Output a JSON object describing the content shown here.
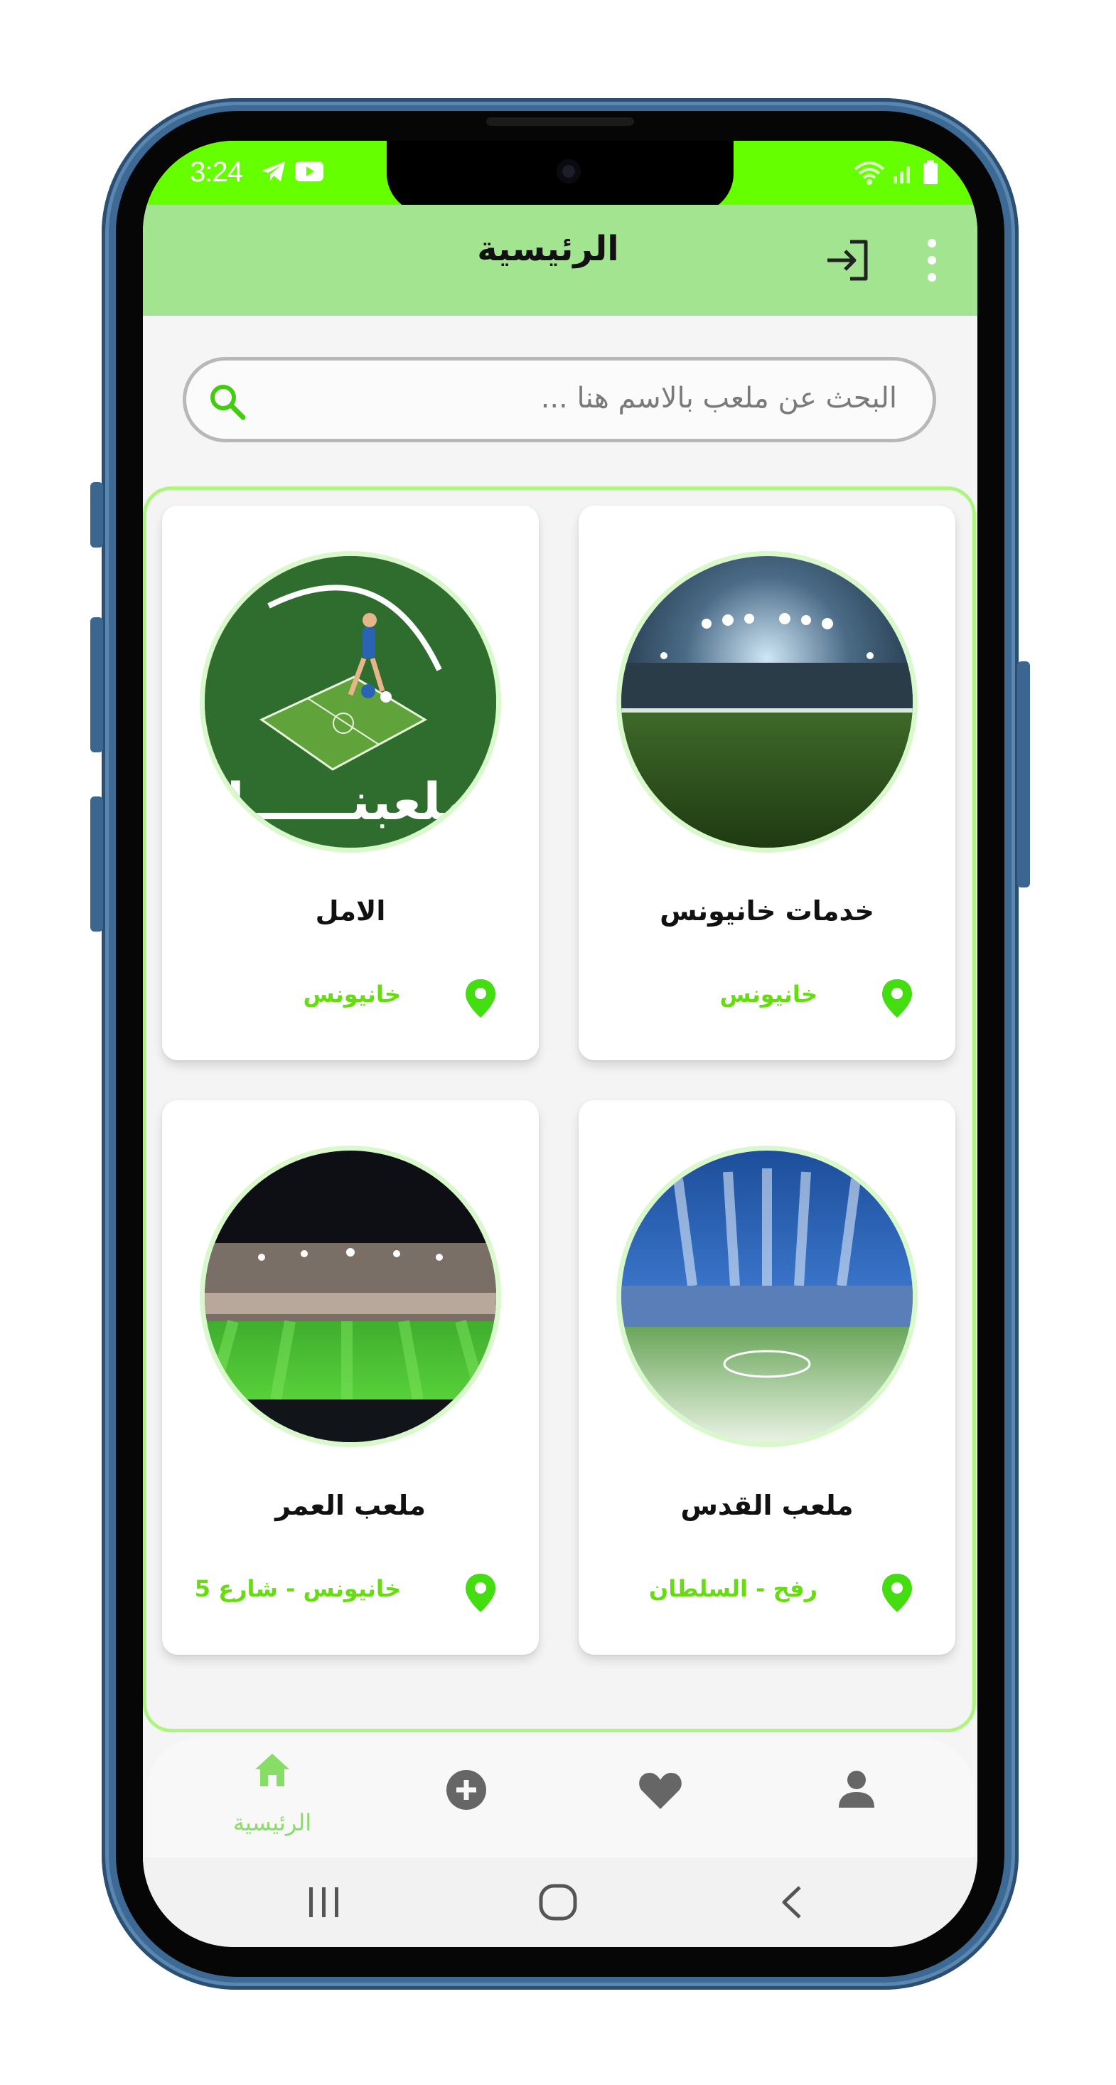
{
  "status_bar": {
    "time": "3:24",
    "left_icons": [
      "telegram-icon",
      "youtube-icon"
    ],
    "right_icons": [
      "wifi-icon",
      "signal-icon",
      "battery-icon"
    ]
  },
  "app_bar": {
    "title": "الرئيسية",
    "actions": [
      "logout-icon",
      "more-vert-icon"
    ]
  },
  "search": {
    "placeholder": "البحث عن ملعب بالاسم هنا ...",
    "icon": "search-icon"
  },
  "stadiums": [
    {
      "name": "خدمات خانيونس",
      "location": "خانيونس",
      "image": "stadium-night-lights"
    },
    {
      "name": "الامل",
      "location": "خانيونس",
      "image": "malabna-logo",
      "logo_text": "ملعبنــــــا"
    },
    {
      "name": "ملعب القدس",
      "location": "رفح - السلطان",
      "image": "stadium-blue-lights"
    },
    {
      "name": "ملعب العمر",
      "location": "خانيونس - شارع 5",
      "image": "stadium-crowd"
    }
  ],
  "bottom_nav": {
    "items": [
      {
        "id": "home",
        "label": "الرئيسية",
        "icon": "home-icon",
        "active": true
      },
      {
        "id": "add",
        "label": "",
        "icon": "add-circle-icon",
        "active": false
      },
      {
        "id": "favorites",
        "label": "",
        "icon": "heart-icon",
        "active": false
      },
      {
        "id": "profile",
        "label": "",
        "icon": "person-icon",
        "active": false
      }
    ]
  },
  "system_nav": [
    "recent-apps-icon",
    "home-circle-icon",
    "back-icon"
  ],
  "colors": {
    "status_bar": "#66ff00",
    "app_bar": "#a2e48f",
    "accent": "#66dd11",
    "nav_active": "#88dd66",
    "nav_inactive": "#666666"
  }
}
